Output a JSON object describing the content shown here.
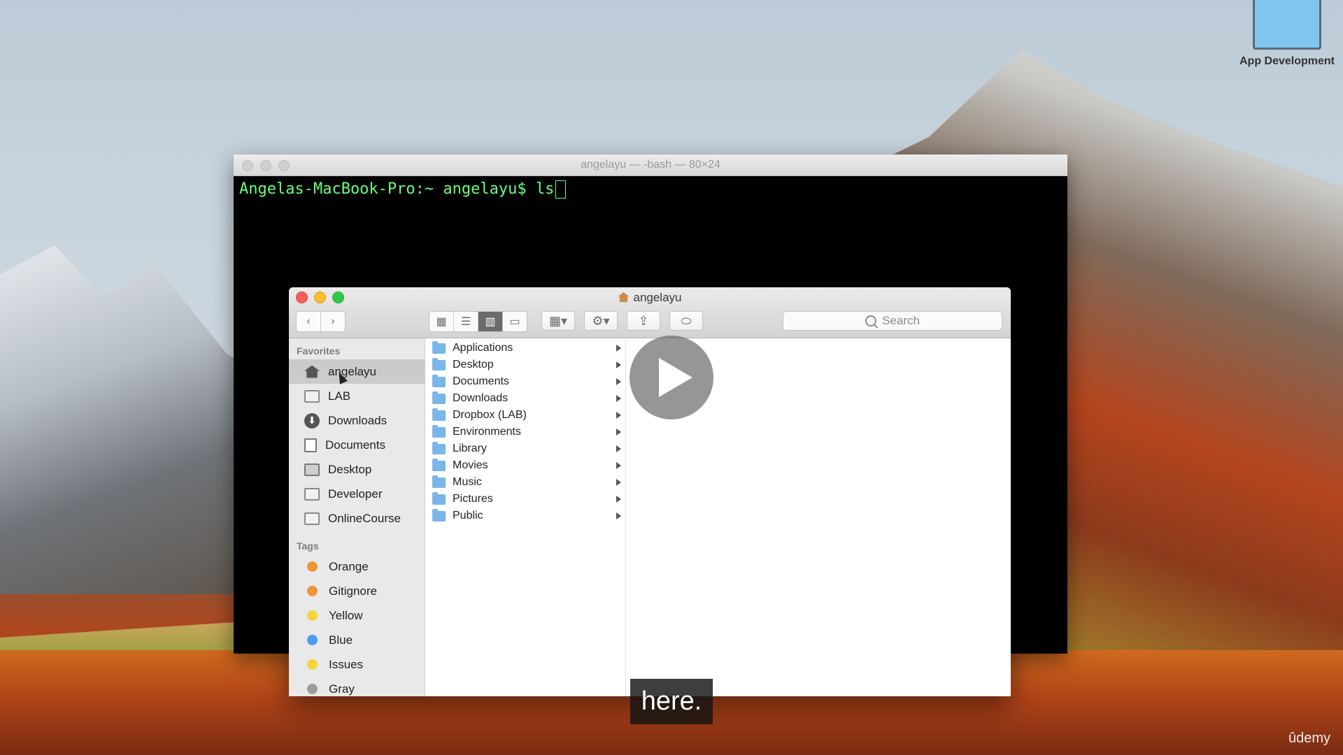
{
  "desktop": {
    "icon_label": "App Development"
  },
  "terminal": {
    "title": "angelayu — -bash — 80×24",
    "prompt": "Angelas-MacBook-Pro:~ angelayu$ ls"
  },
  "finder": {
    "title": "angelayu",
    "search_placeholder": "Search",
    "sidebar": {
      "favorites_header": "Favorites",
      "favorites": [
        {
          "label": "angelayu",
          "icon": "home-icon"
        },
        {
          "label": "LAB",
          "icon": "folder-icon"
        },
        {
          "label": "Downloads",
          "icon": "download-icon"
        },
        {
          "label": "Documents",
          "icon": "documents-icon"
        },
        {
          "label": "Desktop",
          "icon": "desktop-icon"
        },
        {
          "label": "Developer",
          "icon": "folder-icon"
        },
        {
          "label": "OnlineCourse",
          "icon": "folder-icon"
        }
      ],
      "tags_header": "Tags",
      "tags": [
        {
          "label": "Orange",
          "color": "#f0953a"
        },
        {
          "label": "Gitignore",
          "color": "#f0953a"
        },
        {
          "label": "Yellow",
          "color": "#f7d43b"
        },
        {
          "label": "Blue",
          "color": "#4a9df5"
        },
        {
          "label": "Issues",
          "color": "#f7d43b"
        },
        {
          "label": "Gray",
          "color": "#9b9b9b"
        }
      ]
    },
    "column_items": [
      "Applications",
      "Desktop",
      "Documents",
      "Downloads",
      "Dropbox (LAB)",
      "Environments",
      "Library",
      "Movies",
      "Music",
      "Pictures",
      "Public"
    ]
  },
  "video": {
    "caption": "here.",
    "brand": "ûdemy"
  }
}
